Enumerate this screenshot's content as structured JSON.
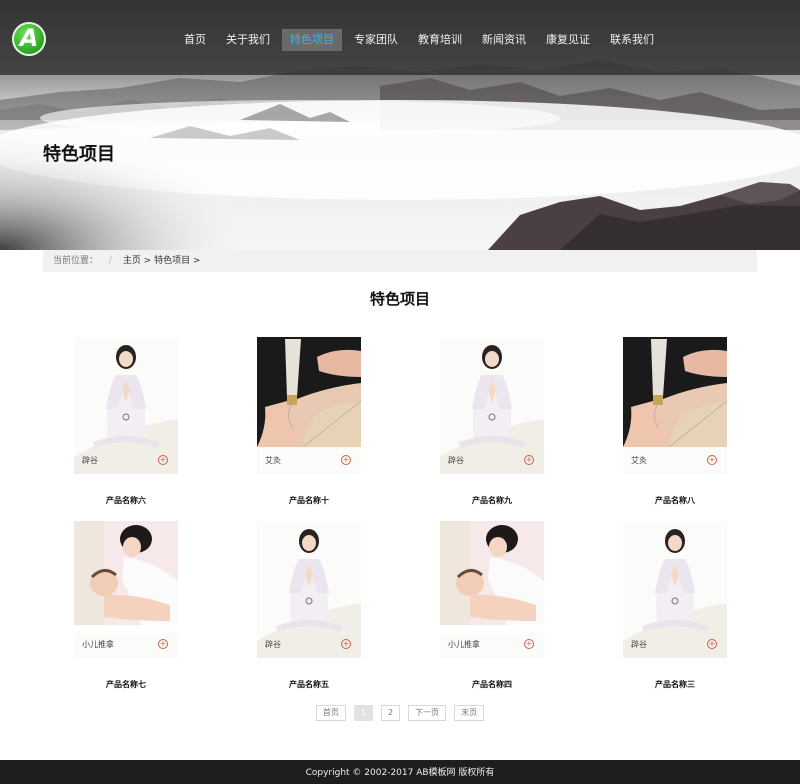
{
  "logo_letter": "A",
  "nav": [
    {
      "label": "首页"
    },
    {
      "label": "关于我们"
    },
    {
      "label": "特色项目",
      "active": true
    },
    {
      "label": "专家团队"
    },
    {
      "label": "教育培训"
    },
    {
      "label": "新闻资讯"
    },
    {
      "label": "康复见证"
    },
    {
      "label": "联系我们"
    }
  ],
  "hero": {
    "title": "特色项目"
  },
  "breadcrumb": {
    "label": "当前位置：",
    "sep": "/",
    "path": "主页 > 特色项目 >"
  },
  "section_title": "特色项目",
  "products": [
    {
      "image": "meditating-woman",
      "tag": "辟谷",
      "name": "产品名称六"
    },
    {
      "image": "moxibustion-hand",
      "tag": "艾灸",
      "name": "产品名称十"
    },
    {
      "image": "meditating-woman",
      "tag": "辟谷",
      "name": "产品名称九"
    },
    {
      "image": "moxibustion-hand",
      "tag": "艾灸",
      "name": "产品名称八"
    },
    {
      "image": "mother-baby-massage",
      "tag": "小儿推拿",
      "name": "产品名称七"
    },
    {
      "image": "meditating-woman",
      "tag": "辟谷",
      "name": "产品名称五"
    },
    {
      "image": "mother-baby-massage",
      "tag": "小儿推拿",
      "name": "产品名称四"
    },
    {
      "image": "meditating-woman",
      "tag": "辟谷",
      "name": "产品名称三"
    }
  ],
  "pagination": {
    "first": "首页",
    "pages": [
      "1",
      "2"
    ],
    "current": "1",
    "next": "下一页",
    "last": "末页"
  },
  "footer": "Copyright © 2002-2017 AB模板网 版权所有",
  "colors": {
    "nav_active_text": "#35b8e8",
    "logo_green": "#2fae2a",
    "accent": "#c4654e"
  }
}
